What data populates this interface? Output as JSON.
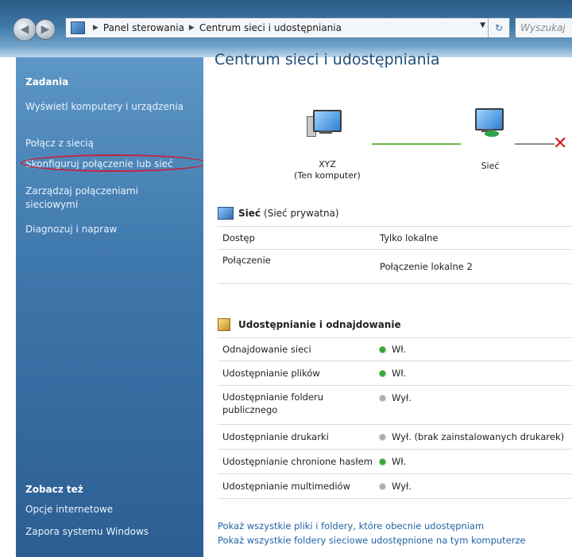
{
  "addressbar": {
    "crumbs": [
      "Panel sterowania",
      "Centrum sieci i udostępniania"
    ],
    "search_placeholder": "Wyszukaj"
  },
  "sidebar": {
    "tasks_heading": "Zadania",
    "tasks": [
      "Wyświetl komputery i urządzenia",
      "Połącz z siecią",
      "Skonfiguruj połączenie lub sieć",
      "Zarządzaj połączeniami sieciowymi",
      "Diagnozuj i napraw"
    ],
    "see_also_heading": "Zobacz też",
    "see_also": [
      "Opcje internetowe",
      "Zapora systemu Windows"
    ]
  },
  "main": {
    "title": "Centrum sieci i udostępniania",
    "map": {
      "computer_name": "XYZ",
      "computer_sub": "(Ten komputer)",
      "network_label": "Sieć"
    },
    "network": {
      "name": "Sieć",
      "type": "(Sieć prywatna)",
      "rows": [
        {
          "key": "Dostęp",
          "value": "Tylko lokalne"
        },
        {
          "key": "Połączenie",
          "value": "Połączenie lokalne 2"
        }
      ]
    },
    "sharing": {
      "heading": "Udostępnianie i odnajdowanie",
      "rows": [
        {
          "key": "Odnajdowanie sieci",
          "value": "Wł.",
          "state": "on"
        },
        {
          "key": "Udostępnianie plików",
          "value": "Wł.",
          "state": "on"
        },
        {
          "key": "Udostępnianie folderu publicznego",
          "value": "Wył.",
          "state": "off"
        },
        {
          "key": "Udostępnianie drukarki",
          "value": "Wył. (brak zainstalowanych drukarek)",
          "state": "off"
        },
        {
          "key": "Udostępnianie chronione hasłem",
          "value": "Wł.",
          "state": "on"
        },
        {
          "key": "Udostępnianie multimediów",
          "value": "Wył.",
          "state": "off"
        }
      ]
    },
    "links": [
      "Pokaż wszystkie pliki i foldery, które obecnie udostępniam",
      "Pokaż wszystkie foldery sieciowe udostępnione na tym komputerze"
    ]
  },
  "colors": {
    "accent": "#2363a6",
    "sidebar": "#3f78ac",
    "highlight_ring": "#c8203a",
    "on": "#3ba43a",
    "off": "#a8aeb5"
  }
}
